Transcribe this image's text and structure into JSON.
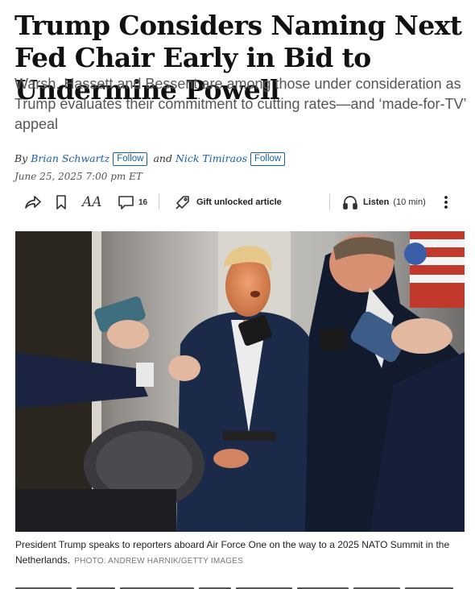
{
  "article": {
    "headline": "Trump Considers Naming Next Fed Chair Early in Bid to Undermine Powell",
    "dek": "Warsh, Hassett and Bessent are among those under consideration as Trump evaluates their commitment to cutting rates—and ‘made-for-TV’ appeal",
    "byline": {
      "by": "By",
      "author1": "Brian Schwartz",
      "and": "and",
      "author2": "Nick Timiraos",
      "follow_label": "Follow"
    },
    "date": "June 25, 2025 7:00 pm ET"
  },
  "toolbar": {
    "share_icon": "share-icon",
    "bookmark_icon": "bookmark-icon",
    "text_size_label": "AA",
    "comments_icon": "comment-icon",
    "comments_count": "16",
    "gift_icon": "gift-icon",
    "gift_label": "Gift unlocked article",
    "listen_icon": "headphones-icon",
    "listen_label": "Listen",
    "listen_duration": "(10 min)",
    "more_icon": "more-vertical-icon"
  },
  "photo": {
    "caption": "President Trump speaks to reporters aboard Air Force One on the way to a 2025 NATO Summit in the Netherlands.",
    "credit": "PHOTO: ANDREW HARNIK/GETTY IMAGES"
  },
  "colors": {
    "link_blue": "#1a5fa8",
    "headline": "#111111",
    "dek": "#555555"
  }
}
